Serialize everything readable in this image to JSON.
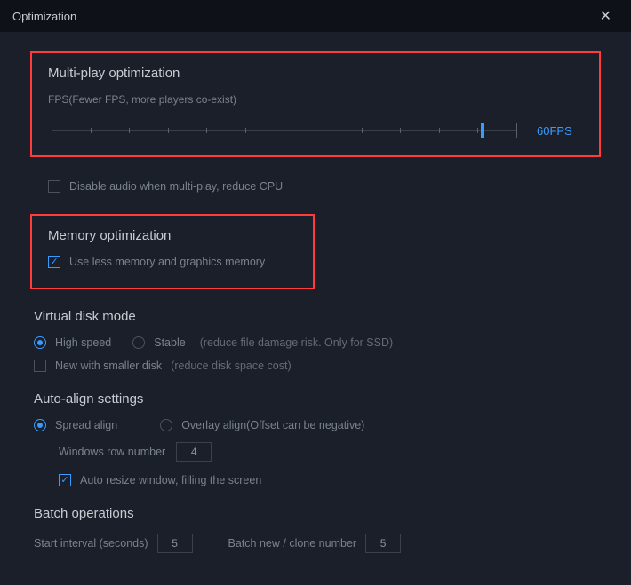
{
  "window": {
    "title": "Optimization"
  },
  "multiplay": {
    "title": "Multi-play optimization",
    "subtitle": "FPS(Fewer FPS, more players co-exist)",
    "fps_label": "60FPS",
    "slider_ticks": 13,
    "slider_value_pct": 92
  },
  "disable_audio": {
    "label": "Disable audio when multi-play, reduce CPU",
    "checked": false
  },
  "memory": {
    "title": "Memory optimization",
    "use_less": {
      "label": "Use less memory and graphics memory",
      "checked": true
    }
  },
  "vdisk": {
    "title": "Virtual disk mode",
    "high_speed": {
      "label": "High speed",
      "checked": true
    },
    "stable": {
      "label": "Stable",
      "checked": false
    },
    "stable_hint": "(reduce file damage risk. Only for SSD)",
    "smaller": {
      "label": "New with smaller disk",
      "checked": false
    },
    "smaller_hint": "(reduce disk space cost)"
  },
  "align": {
    "title": "Auto-align settings",
    "spread": {
      "label": "Spread align",
      "checked": true
    },
    "overlay": {
      "label": "Overlay align(Offset can be negative)",
      "checked": false
    },
    "row_number_label": "Windows row number",
    "row_number_value": "4",
    "auto_resize": {
      "label": "Auto resize window, filling the screen",
      "checked": true
    }
  },
  "batch": {
    "title": "Batch operations",
    "start_interval_label": "Start interval (seconds)",
    "start_interval_value": "5",
    "clone_label": "Batch new / clone number",
    "clone_value": "5"
  }
}
